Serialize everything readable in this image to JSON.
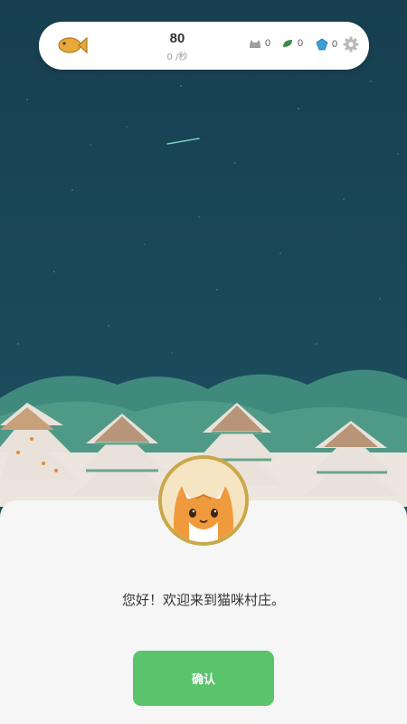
{
  "top_bar": {
    "fish_count": "80",
    "fish_rate": "0 /秒",
    "cat_count": "0",
    "leaf_count": "0",
    "gem_count": "0",
    "icons": [
      "fish-icon",
      "cat-icon",
      "leaf-icon",
      "gem-icon",
      "gear-icon"
    ]
  },
  "dialog": {
    "message": "您好！欢迎来到猫咪村庄。",
    "confirm_label": "确认"
  },
  "colors": {
    "sky": "#1b4d5e",
    "panel": "#f6f6f6",
    "accent_green": "#5cc36d",
    "fish_gold": "#e6a93a"
  }
}
